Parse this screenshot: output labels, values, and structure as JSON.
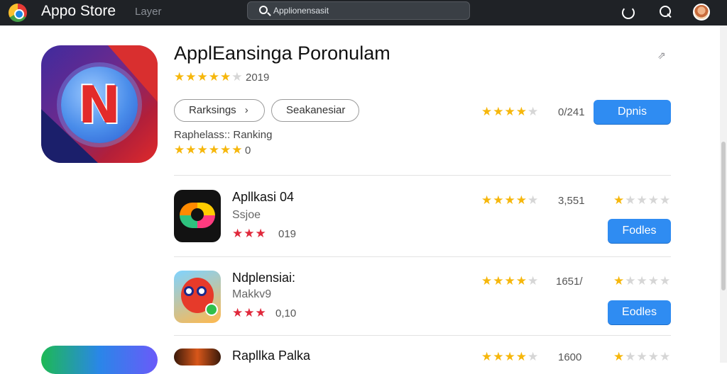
{
  "topbar": {
    "app_title": "Appo Store",
    "nav_link": "Layer",
    "search_value": "Applionensasit"
  },
  "colors": {
    "accent": "#2f8cf2",
    "star": "#f6b70c",
    "star_red": "#e0283b",
    "topbar_bg": "#1f2226"
  },
  "featured": {
    "title": "ApplEansinga Poronulam",
    "stars_filled": 5,
    "rating_text": "2019",
    "pill_1": "Rarksings",
    "pill_1_chevron": "›",
    "pill_2": "Seakanesiar",
    "sub_label": "Raphelass:: Ranking",
    "stars2_filled": 6,
    "rating2_text": "0",
    "right_rating": "0/241",
    "button": "Dpnis",
    "icon_letter": "N"
  },
  "rows": [
    {
      "title": "Apllkasi 04",
      "subtitle": "Ssjoe",
      "red_stars": 3,
      "red_rating": "019",
      "right_rating": "3,551",
      "mini_stars_filled": 1,
      "button": "Fodles"
    },
    {
      "title": "Ndplensiai:",
      "subtitle": "Makkv9",
      "red_stars": 3,
      "red_rating": "0,10",
      "right_rating": "1651/",
      "mini_stars_filled": 1,
      "button": "Eodles"
    },
    {
      "title": "Rapllka Palka",
      "right_rating": "1600",
      "mini_stars_filled": 1
    }
  ]
}
